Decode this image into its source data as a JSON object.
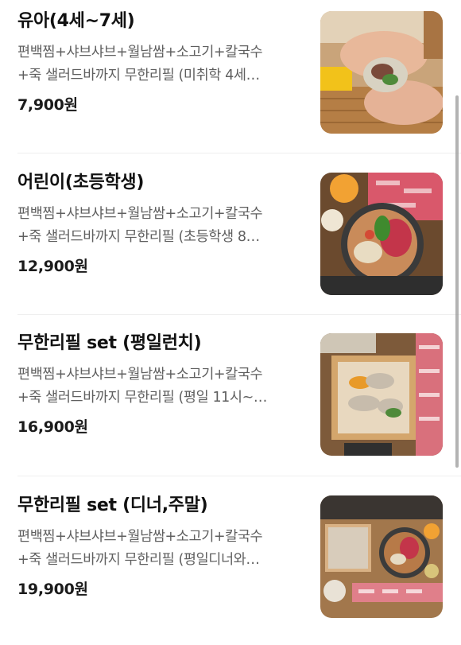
{
  "menu": {
    "items": [
      {
        "name": "유아(4세~7세)",
        "desc_line1": "편백찜+샤브샤브+월남쌈+소고기+칼국수",
        "desc_line2": "+죽 샐러드바까지 무한리필 (미취학 4세…",
        "price": "7,900원"
      },
      {
        "name": "어린이(초등학생)",
        "desc_line1": "편백찜+샤브샤브+월남쌈+소고기+칼국수",
        "desc_line2": "+죽 샐러드바까지 무한리필 (초등학생 8…",
        "price": "12,900원"
      },
      {
        "name": "무한리필 set (평일런치)",
        "desc_line1": "편백찜+샤브샤브+월남쌈+소고기+칼국수",
        "desc_line2": "+죽 샐러드바까지 무한리필 (평일 11시~…",
        "price": "16,900원"
      },
      {
        "name": "무한리필 set (디너,주말)",
        "desc_line1": "편백찜+샤브샤브+월남쌈+소고기+칼국수",
        "desc_line2": "+죽 샐러드바까지 무한리필 (평일디너와…",
        "price": "19,900원"
      }
    ]
  },
  "colors": {
    "title": "#111111",
    "description": "#5f5f5f",
    "price": "#1b1b1b",
    "divider": "#efefef"
  }
}
